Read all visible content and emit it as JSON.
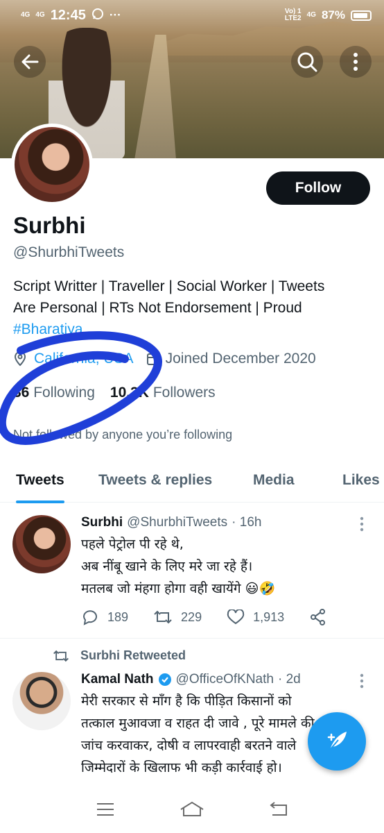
{
  "status_bar": {
    "signal_1": "4G",
    "signal_2": "4G",
    "time": "12:45",
    "network_label": "Vo) 1\nLTE2",
    "network_2": "4G",
    "battery": "87%"
  },
  "profile": {
    "name": "Surbhi",
    "handle": "@ShurbhiTweets",
    "follow_label": "Follow",
    "bio_line1": "Script Writter | Traveller | Social Worker | Tweets",
    "bio_line2": "Are Personal | RTs Not Endorsement | Proud",
    "bio_hashtag": "#Bharatiya",
    "location": "California, USA",
    "joined": "Joined December 2020",
    "following_count": "36",
    "following_label": "Following",
    "followers_count": "10.3K",
    "followers_label": "Followers",
    "not_followed_text": "Not followed by anyone you’re following"
  },
  "tabs": [
    {
      "label": "Tweets",
      "active": true
    },
    {
      "label": "Tweets & replies",
      "active": false
    },
    {
      "label": "Media",
      "active": false
    },
    {
      "label": "Likes",
      "active": false
    }
  ],
  "tweets": [
    {
      "name": "Surbhi",
      "handle": "@ShurbhiTweets",
      "time": "· 16h",
      "line1": "पहले पेट्रोल पी रहे थे,",
      "line2": "अब नींबू खाने के लिए मरे जा रहे हैं।",
      "line3": "मतलब जो मंहगा होगा वही खायेंगे 😃🤣",
      "replies": "189",
      "retweets": "229",
      "likes": "1,913"
    },
    {
      "retweeted_by": "Surbhi Retweeted",
      "name": "Kamal Nath",
      "handle": "@OfficeOfKNath",
      "time": "· 2d",
      "line1": "मेरी सरकार से माँग है कि पीड़ित किसानों को",
      "line2": "तत्काल मुआवजा व राहत दी जावे , पूरे मामले की",
      "line3": "जांच करवाकर, दोषी व लापरवाही बरतने वाले",
      "line4": "जिम्मेदारों के खिलाफ भी कड़ी कार्रवाई हो।"
    }
  ],
  "colors": {
    "accent": "#1d9bf0",
    "text": "#0f1419",
    "secondary": "#536471",
    "scribble": "#1f3fd8"
  }
}
